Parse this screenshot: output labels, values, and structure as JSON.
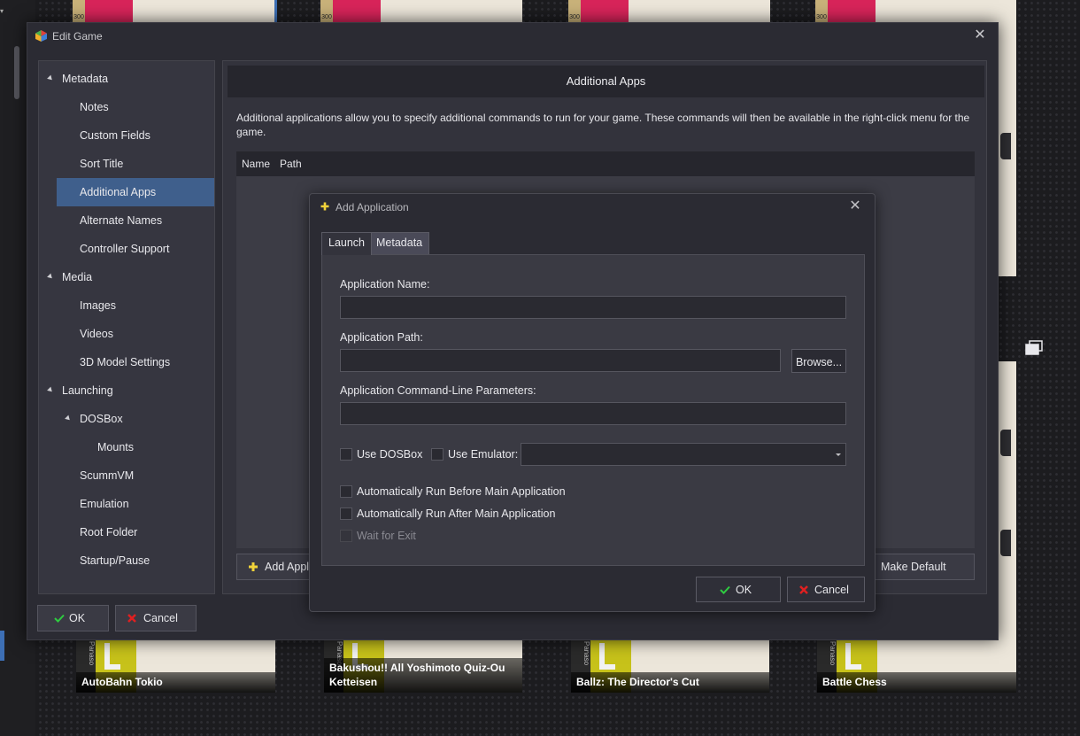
{
  "background": {
    "tiles_bottom": [
      {
        "title": "AutoBahn Tokio",
        "publisher": "Panaso"
      },
      {
        "title": "Bakushou!! All Yoshimoto Quiz-Ou Ketteisen",
        "publisher": "Panaso"
      },
      {
        "title": "Ballz: The Director's Cut",
        "publisher": "Panaso"
      },
      {
        "title": "Battle Chess",
        "publisher": "Panaso"
      }
    ],
    "tile_badge": "300"
  },
  "window": {
    "title": "Edit Game",
    "close_icon": "close-icon",
    "ok_label": "OK",
    "cancel_label": "Cancel"
  },
  "nav": {
    "items": [
      {
        "label": "Metadata",
        "level": 0,
        "expanded": true,
        "selected": false
      },
      {
        "label": "Notes",
        "level": 1,
        "selected": false
      },
      {
        "label": "Custom Fields",
        "level": 1,
        "selected": false
      },
      {
        "label": "Sort Title",
        "level": 1,
        "selected": false
      },
      {
        "label": "Additional Apps",
        "level": 1,
        "selected": true
      },
      {
        "label": "Alternate Names",
        "level": 1,
        "selected": false
      },
      {
        "label": "Controller Support",
        "level": 1,
        "selected": false
      },
      {
        "label": "Media",
        "level": 0,
        "expanded": true,
        "selected": false
      },
      {
        "label": "Images",
        "level": 1,
        "selected": false
      },
      {
        "label": "Videos",
        "level": 1,
        "selected": false
      },
      {
        "label": "3D Model Settings",
        "level": 1,
        "selected": false
      },
      {
        "label": "Launching",
        "level": 0,
        "expanded": true,
        "selected": false
      },
      {
        "label": "DOSBox",
        "level": 1,
        "expanded": true,
        "selected": false
      },
      {
        "label": "Mounts",
        "level": 2,
        "selected": false
      },
      {
        "label": "ScummVM",
        "level": 1,
        "selected": false
      },
      {
        "label": "Emulation",
        "level": 1,
        "selected": false
      },
      {
        "label": "Root Folder",
        "level": 1,
        "selected": false
      },
      {
        "label": "Startup/Pause",
        "level": 1,
        "selected": false
      }
    ]
  },
  "main": {
    "header": "Additional Apps",
    "description": "Additional applications allow you to specify additional commands to run for your game.  These commands will then be available in the right-click menu for the game.",
    "grid_columns": [
      "Name",
      "Path"
    ],
    "add_button_label": "Add Appli",
    "make_default_label": "Make Default"
  },
  "dialog": {
    "title": "Add Application",
    "tabs": [
      {
        "label": "Launch",
        "active": true
      },
      {
        "label": "Metadata",
        "active": false
      }
    ],
    "app_name_label": "Application Name:",
    "app_name_value": "",
    "app_path_label": "Application Path:",
    "app_path_value": "",
    "browse_label": "Browse...",
    "cmd_params_label": "Application Command-Line Parameters:",
    "cmd_params_value": "",
    "use_dosbox_label": "Use DOSBox",
    "use_emulator_label": "Use Emulator:",
    "emulator_selected": "",
    "auto_before_label": "Automatically Run Before Main Application",
    "auto_after_label": "Automatically Run After Main Application",
    "wait_exit_label": "Wait for Exit",
    "ok_label": "OK",
    "cancel_label": "Cancel"
  },
  "colors": {
    "selection": "#3f5f8c",
    "ok_check": "#2ecc40",
    "cancel_x": "#e02020"
  }
}
